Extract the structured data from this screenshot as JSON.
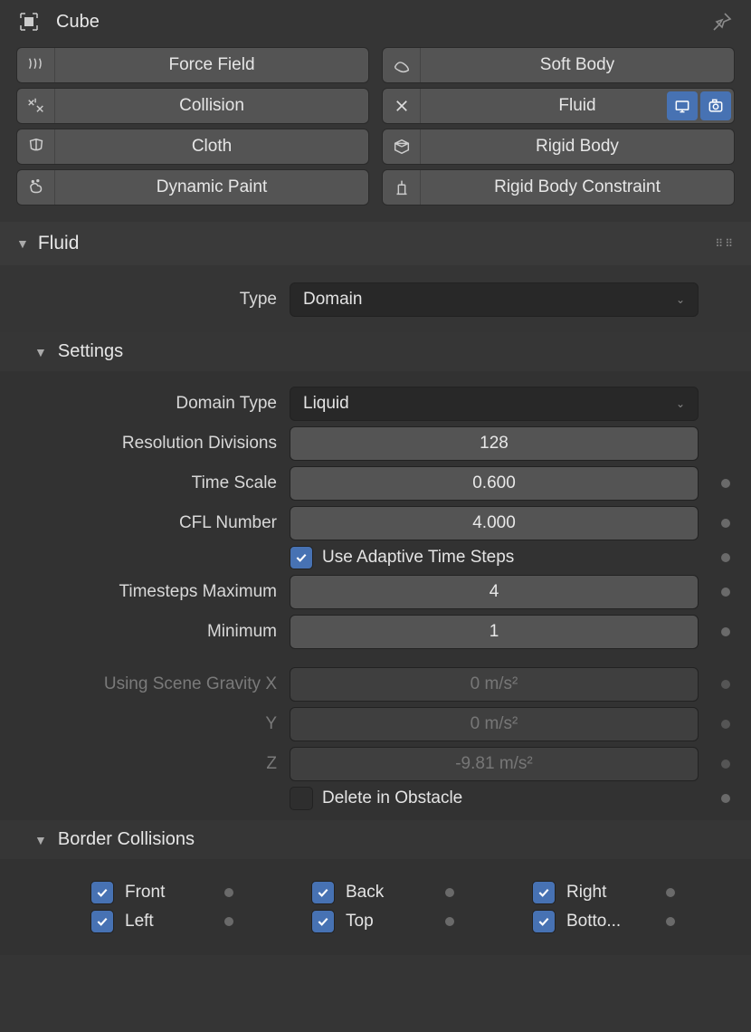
{
  "header": {
    "object_name": "Cube"
  },
  "physics_buttons": {
    "force_field": "Force Field",
    "soft_body": "Soft Body",
    "collision": "Collision",
    "fluid": "Fluid",
    "cloth": "Cloth",
    "rigid_body": "Rigid Body",
    "dynamic_paint": "Dynamic Paint",
    "rigid_body_constraint": "Rigid Body Constraint"
  },
  "panel": {
    "fluid_title": "Fluid",
    "settings_title": "Settings",
    "type_label": "Type",
    "type_value": "Domain",
    "domain_type_label": "Domain Type",
    "domain_type_value": "Liquid",
    "resolution_label": "Resolution Divisions",
    "resolution_value": "128",
    "time_scale_label": "Time Scale",
    "time_scale_value": "0.600",
    "cfl_label": "CFL Number",
    "cfl_value": "4.000",
    "adaptive_label": "Use Adaptive Time Steps",
    "adaptive_checked": true,
    "ts_max_label": "Timesteps Maximum",
    "ts_max_value": "4",
    "ts_min_label": "Minimum",
    "ts_min_value": "1",
    "gravity_label": "Using Scene Gravity X",
    "gravity_x": "0 m/s²",
    "gravity_y_label": "Y",
    "gravity_y": "0 m/s²",
    "gravity_z_label": "Z",
    "gravity_z": "-9.81 m/s²",
    "delete_label": "Delete in Obstacle",
    "delete_checked": false,
    "border_title": "Border Collisions",
    "border": {
      "front": "Front",
      "back": "Back",
      "right": "Right",
      "left": "Left",
      "top": "Top",
      "bottom": "Botto..."
    }
  }
}
